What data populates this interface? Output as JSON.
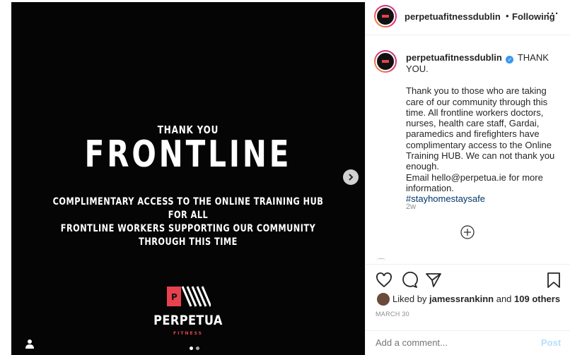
{
  "media": {
    "line1": "THANK YOU",
    "line2": "FRONTLINE",
    "line3": "COMPLIMENTARY ACCESS TO THE ONLINE TRAINING HUB FOR ALL\nFRONTLINE WORKERS SUPPORTING OUR COMMUNITY THROUGH THIS TIME",
    "brand": "PERPETUA",
    "brand_sub": "FITNESS",
    "carousel": {
      "count": 2,
      "active": 1
    }
  },
  "header": {
    "username": "perpetuafitnessdublin",
    "separator": "•",
    "follow_status": "Following",
    "more": "···"
  },
  "caption": {
    "username": "perpetuafitnessdublin",
    "title": "THANK YOU.",
    "body": "Thank you to those who are taking care of our community through this time. All frontline workers doctors, nurses, health care staff, Gardai, paramedics and firefighters have complimentary access to the Online Training HUB. We can not thank you enough.\nEmail hello@perpetua.ie for more information.",
    "hashtag": "#stayhomestaysafe",
    "time_ago": "2w"
  },
  "likes": {
    "prefix": "Liked by",
    "user": "jamessrankinn",
    "middle": "and",
    "others": "109 others"
  },
  "date": "MARCH 30",
  "comment": {
    "placeholder": "Add a comment...",
    "post_label": "Post"
  },
  "colors": {
    "brand_red": "#e8424f",
    "verified_blue": "#3897f0",
    "post_blue": "#b2dffc"
  }
}
